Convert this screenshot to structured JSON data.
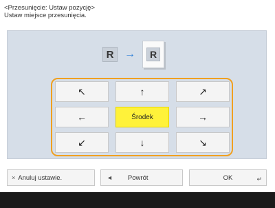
{
  "header": {
    "title": "<Przesunięcie: Ustaw pozycję>",
    "subtitle": "Ustaw miejsce przesunięcia."
  },
  "preview": {
    "source_letter": "R",
    "arrow": "→",
    "target_letter": "R"
  },
  "positions": {
    "top_left": "↖",
    "top": "↑",
    "top_right": "↗",
    "left": "←",
    "center": "Środek",
    "right": "→",
    "bottom_left": "↙",
    "bottom": "↓",
    "bottom_right": "↘",
    "selected": "center"
  },
  "buttons": {
    "cancel": "Anuluj ustawie.",
    "cancel_icon": "×",
    "back": "Powrót",
    "back_icon": "◄",
    "ok": "OK",
    "ok_icon": "↵"
  },
  "colors": {
    "highlight": "#fff23a",
    "frame": "#f0a020",
    "panel": "#d6dee8",
    "arrow_blue": "#2f80d8"
  }
}
